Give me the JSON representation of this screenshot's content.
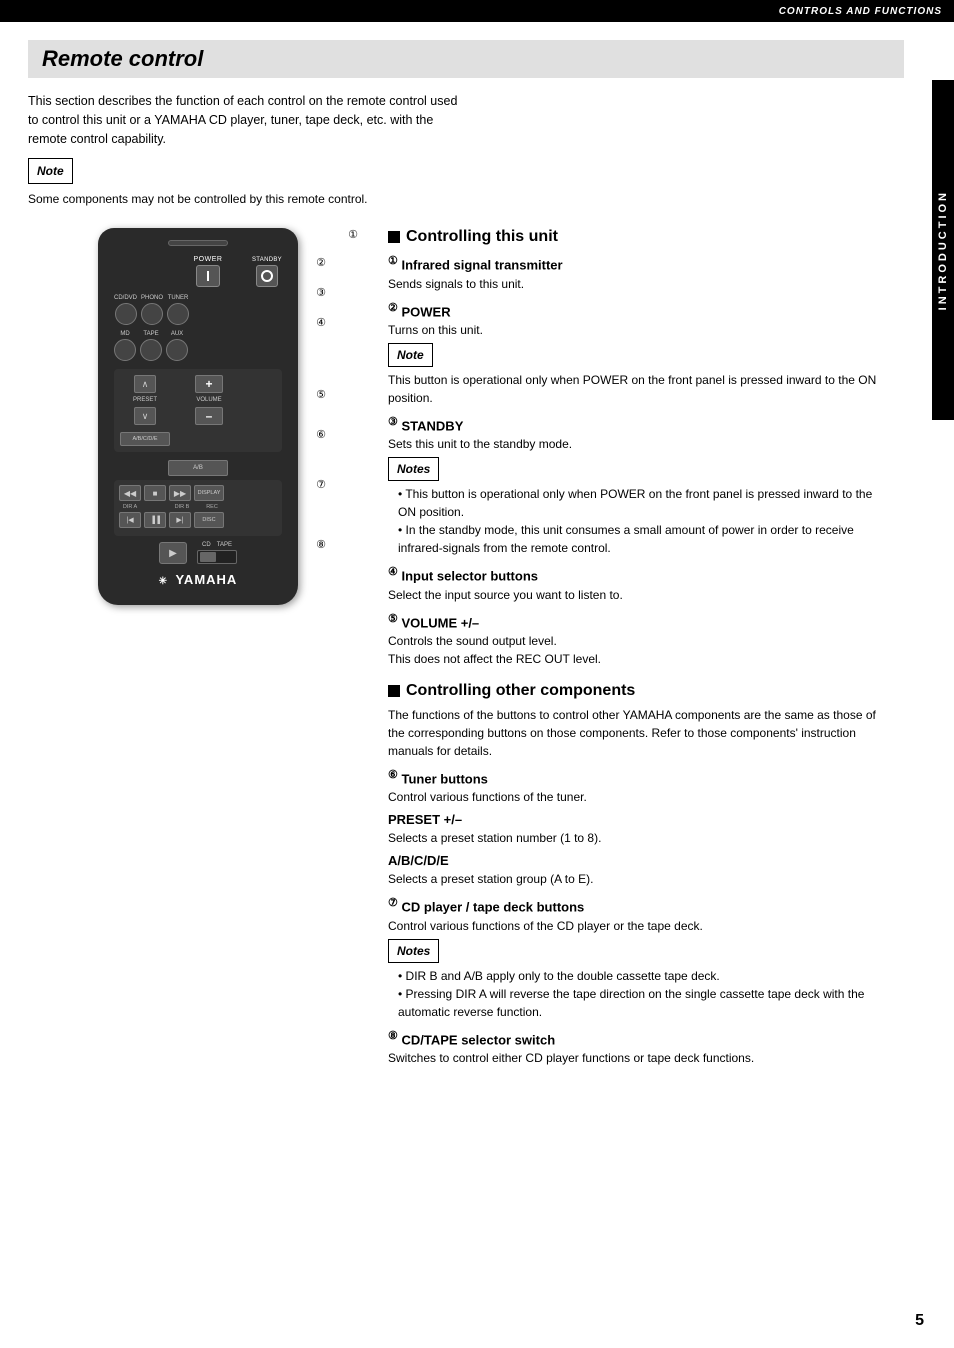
{
  "topBar": {
    "text": "CONTROLS AND FUNCTIONS"
  },
  "sideTab": {
    "text": "INTRODUCTION"
  },
  "pageNum": "5",
  "title": "Remote control",
  "introText": "This section describes the function of each control on the remote control used to control this unit or a YAMAHA CD player, tuner, tape deck, etc. with the remote control capability.",
  "noteLabel": "Note",
  "noteText": "Some components may not be controlled by this remote control.",
  "rightCol": {
    "controllingThisUnit": {
      "heading": "Controlling this unit",
      "items": [
        {
          "num": "①",
          "label": "Infrared signal transmitter",
          "text": "Sends signals to this unit."
        },
        {
          "num": "②",
          "label": "POWER",
          "text": "Turns on this unit."
        }
      ],
      "powerNote": {
        "label": "Note",
        "text": "This button is operational only when POWER on the front panel is pressed inward to the ON position."
      },
      "items2": [
        {
          "num": "③",
          "label": "STANDBY",
          "text": "Sets this unit to the standby mode."
        }
      ],
      "standbyNotes": {
        "label": "Notes",
        "bullets": [
          "This button is operational only when POWER on the front panel is pressed inward to the ON position.",
          "In the standby mode, this unit consumes a small amount of power in order to receive infrared-signals from the remote control."
        ]
      },
      "items3": [
        {
          "num": "④",
          "label": "Input selector buttons",
          "text": "Select the input source you want to listen to."
        },
        {
          "num": "⑤",
          "label": "VOLUME +/–",
          "text": "Controls the sound output level.\nThis does not affect the REC OUT level."
        }
      ]
    },
    "controllingOtherComponents": {
      "heading": "Controlling other components",
      "introText": "The functions of the buttons to control other YAMAHA components are the same as those of the corresponding buttons on those components. Refer to those components' instruction manuals for details.",
      "items": [
        {
          "num": "⑥",
          "label": "Tuner buttons",
          "text": "Control various functions of the tuner."
        }
      ],
      "presetHeading": "PRESET +/–",
      "presetText": "Selects a preset station number (1 to 8).",
      "abcdeHeading": "A/B/C/D/E",
      "abcdeText": "Selects a preset station group (A to E).",
      "items2": [
        {
          "num": "⑦",
          "label": "CD player / tape deck buttons",
          "text": "Control various functions of the CD player or the tape deck."
        }
      ],
      "cdNotes": {
        "label": "Notes",
        "bullets": [
          "DIR B and A/B apply only to the double cassette tape deck.",
          "Pressing DIR A will reverse the tape direction on the single cassette tape deck with the automatic reverse function."
        ]
      },
      "items3": [
        {
          "num": "⑧",
          "label": "CD/TAPE selector switch",
          "text": "Switches to control either CD player functions or tape deck functions."
        }
      ]
    }
  },
  "remote": {
    "powerLabel": "POWER",
    "standbyLabel": "STANDBY",
    "sourceBtns": [
      "CD/DVD",
      "PHONO",
      "TUNER",
      "MD",
      "TAPE",
      "AUX"
    ],
    "volumeLabel": "VOLUME",
    "presetLabel": "PRESET",
    "abcdeLabel": "A/B/C/D/E",
    "dirA": "DIR A",
    "dirB": "DIR B",
    "rec": "REC",
    "disc": "DISC",
    "cd": "CD",
    "tape": "TAPE",
    "yamaha": "YAMAHA"
  }
}
